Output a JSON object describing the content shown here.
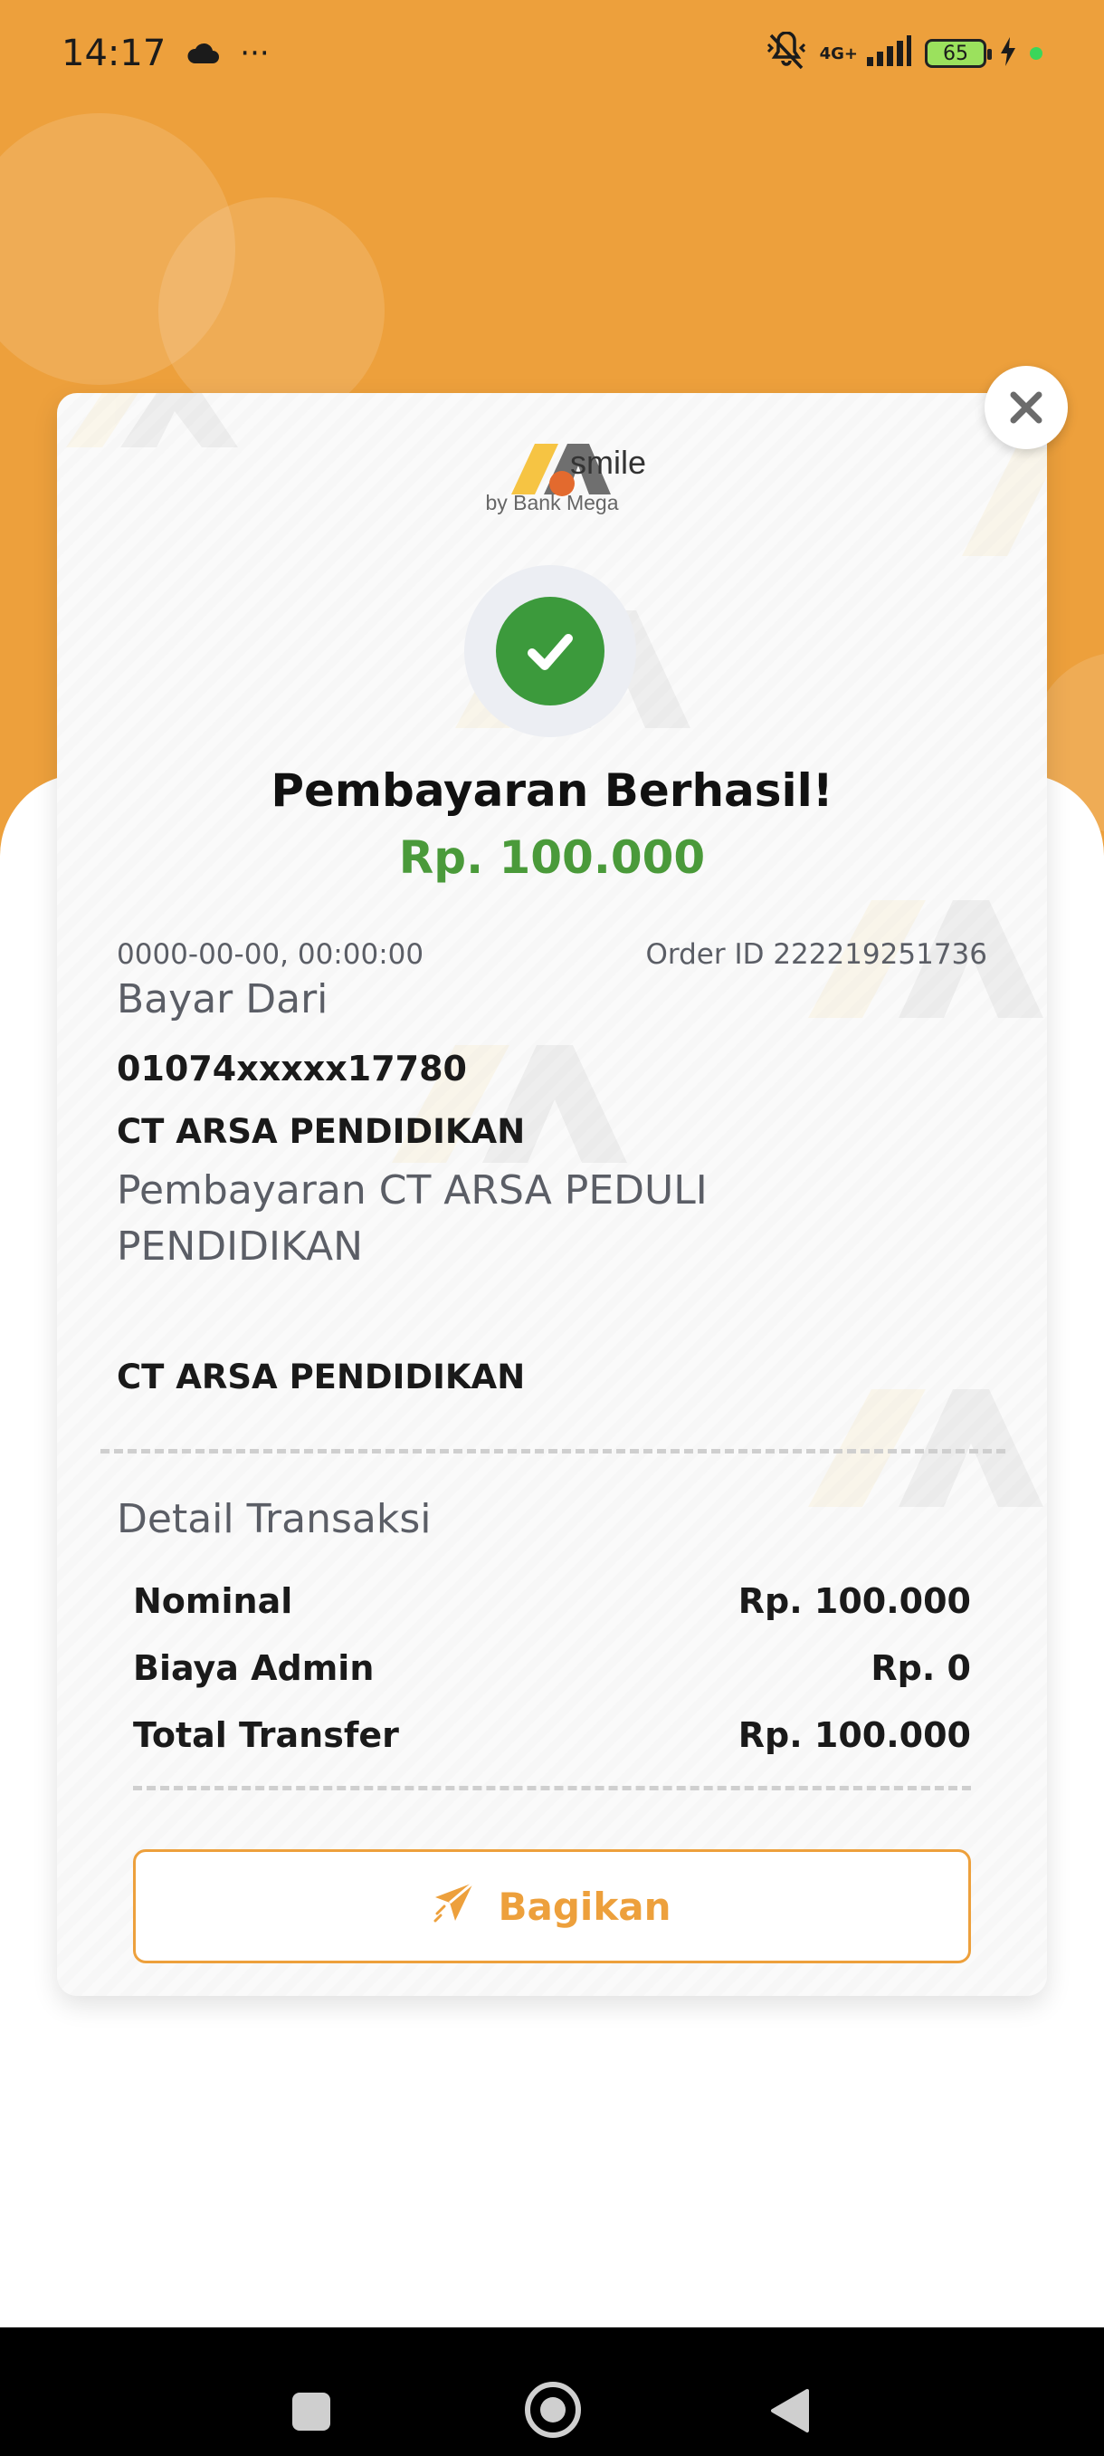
{
  "status_bar": {
    "time": "14:17",
    "more": "···",
    "network": "4G+",
    "battery": "65",
    "icons": [
      "cloud-icon",
      "mute-icon",
      "signal-icon",
      "battery-icon",
      "charging-icon"
    ]
  },
  "brand": {
    "word": "smile",
    "sub": "by Bank Mega",
    "colors": {
      "orange": "#eda03c",
      "yellow": "#f6c443",
      "grey": "#6f6f6f",
      "accent": "#e36a2e"
    }
  },
  "receipt": {
    "title": "Pembayaran Berhasil!",
    "amount": "Rp. 100.000",
    "datetime": "0000-00-00, 00:00:00",
    "order_id": "Order ID 222219251736",
    "from_label": "Bayar Dari",
    "from_account": "01074xxxxx17780",
    "merchant_name": "CT ARSA PENDIDIKAN",
    "description": "Pembayaran CT ARSA PEDULI PENDIDIKAN",
    "merchant_name_2": "CT ARSA PENDIDIKAN"
  },
  "detail": {
    "title": "Detail Transaksi",
    "rows": [
      {
        "label": "Nominal",
        "value": "Rp. 100.000"
      },
      {
        "label": "Biaya Admin",
        "value": "Rp. 0"
      },
      {
        "label": "Total Transfer",
        "value": "Rp. 100.000"
      }
    ]
  },
  "actions": {
    "share_label": "Bagikan"
  },
  "colors": {
    "success_green": "#3c9a3c",
    "amount_green": "#4a9a3a",
    "header_orange": "#eda03c"
  }
}
